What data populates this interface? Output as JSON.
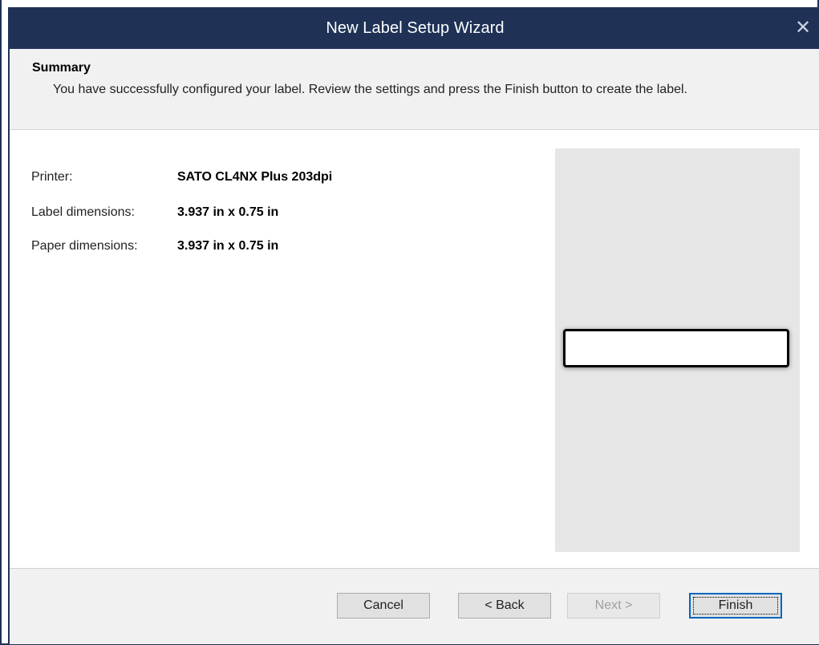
{
  "window": {
    "title": "New Label Setup Wizard",
    "close_glyph": "✕"
  },
  "header": {
    "title": "Summary",
    "description": "You have successfully configured your label. Review the settings and press the Finish button to create the label."
  },
  "summary": {
    "rows": [
      {
        "label": "Printer:",
        "value": "SATO CL4NX Plus 203dpi"
      },
      {
        "label": "Label dimensions:",
        "value": "3.937 in x 0.75 in"
      },
      {
        "label": "Paper dimensions:",
        "value": "3.937 in x 0.75 in"
      }
    ]
  },
  "footer": {
    "cancel_label": "Cancel",
    "back_label": "< Back",
    "next_label": "Next >",
    "finish_label": "Finish"
  },
  "colors": {
    "titlebar": "#1f3256",
    "panel": "#f1f1f1",
    "preview_bg": "#e6e6e6",
    "focus_border": "#0067c0"
  }
}
